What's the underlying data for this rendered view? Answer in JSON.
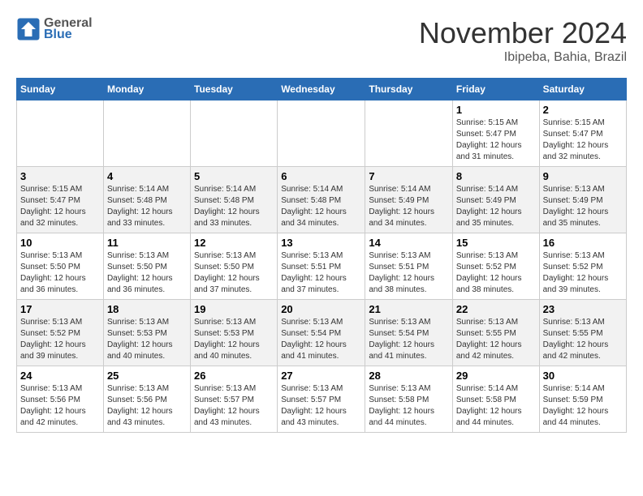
{
  "header": {
    "logo_general": "General",
    "logo_blue": "Blue",
    "month": "November 2024",
    "location": "Ibipeba, Bahia, Brazil"
  },
  "days_of_week": [
    "Sunday",
    "Monday",
    "Tuesday",
    "Wednesday",
    "Thursday",
    "Friday",
    "Saturday"
  ],
  "weeks": [
    [
      {
        "day": "",
        "info": ""
      },
      {
        "day": "",
        "info": ""
      },
      {
        "day": "",
        "info": ""
      },
      {
        "day": "",
        "info": ""
      },
      {
        "day": "",
        "info": ""
      },
      {
        "day": "1",
        "info": "Sunrise: 5:15 AM\nSunset: 5:47 PM\nDaylight: 12 hours and 31 minutes."
      },
      {
        "day": "2",
        "info": "Sunrise: 5:15 AM\nSunset: 5:47 PM\nDaylight: 12 hours and 32 minutes."
      }
    ],
    [
      {
        "day": "3",
        "info": "Sunrise: 5:15 AM\nSunset: 5:47 PM\nDaylight: 12 hours and 32 minutes."
      },
      {
        "day": "4",
        "info": "Sunrise: 5:14 AM\nSunset: 5:48 PM\nDaylight: 12 hours and 33 minutes."
      },
      {
        "day": "5",
        "info": "Sunrise: 5:14 AM\nSunset: 5:48 PM\nDaylight: 12 hours and 33 minutes."
      },
      {
        "day": "6",
        "info": "Sunrise: 5:14 AM\nSunset: 5:48 PM\nDaylight: 12 hours and 34 minutes."
      },
      {
        "day": "7",
        "info": "Sunrise: 5:14 AM\nSunset: 5:49 PM\nDaylight: 12 hours and 34 minutes."
      },
      {
        "day": "8",
        "info": "Sunrise: 5:14 AM\nSunset: 5:49 PM\nDaylight: 12 hours and 35 minutes."
      },
      {
        "day": "9",
        "info": "Sunrise: 5:13 AM\nSunset: 5:49 PM\nDaylight: 12 hours and 35 minutes."
      }
    ],
    [
      {
        "day": "10",
        "info": "Sunrise: 5:13 AM\nSunset: 5:50 PM\nDaylight: 12 hours and 36 minutes."
      },
      {
        "day": "11",
        "info": "Sunrise: 5:13 AM\nSunset: 5:50 PM\nDaylight: 12 hours and 36 minutes."
      },
      {
        "day": "12",
        "info": "Sunrise: 5:13 AM\nSunset: 5:50 PM\nDaylight: 12 hours and 37 minutes."
      },
      {
        "day": "13",
        "info": "Sunrise: 5:13 AM\nSunset: 5:51 PM\nDaylight: 12 hours and 37 minutes."
      },
      {
        "day": "14",
        "info": "Sunrise: 5:13 AM\nSunset: 5:51 PM\nDaylight: 12 hours and 38 minutes."
      },
      {
        "day": "15",
        "info": "Sunrise: 5:13 AM\nSunset: 5:52 PM\nDaylight: 12 hours and 38 minutes."
      },
      {
        "day": "16",
        "info": "Sunrise: 5:13 AM\nSunset: 5:52 PM\nDaylight: 12 hours and 39 minutes."
      }
    ],
    [
      {
        "day": "17",
        "info": "Sunrise: 5:13 AM\nSunset: 5:52 PM\nDaylight: 12 hours and 39 minutes."
      },
      {
        "day": "18",
        "info": "Sunrise: 5:13 AM\nSunset: 5:53 PM\nDaylight: 12 hours and 40 minutes."
      },
      {
        "day": "19",
        "info": "Sunrise: 5:13 AM\nSunset: 5:53 PM\nDaylight: 12 hours and 40 minutes."
      },
      {
        "day": "20",
        "info": "Sunrise: 5:13 AM\nSunset: 5:54 PM\nDaylight: 12 hours and 41 minutes."
      },
      {
        "day": "21",
        "info": "Sunrise: 5:13 AM\nSunset: 5:54 PM\nDaylight: 12 hours and 41 minutes."
      },
      {
        "day": "22",
        "info": "Sunrise: 5:13 AM\nSunset: 5:55 PM\nDaylight: 12 hours and 42 minutes."
      },
      {
        "day": "23",
        "info": "Sunrise: 5:13 AM\nSunset: 5:55 PM\nDaylight: 12 hours and 42 minutes."
      }
    ],
    [
      {
        "day": "24",
        "info": "Sunrise: 5:13 AM\nSunset: 5:56 PM\nDaylight: 12 hours and 42 minutes."
      },
      {
        "day": "25",
        "info": "Sunrise: 5:13 AM\nSunset: 5:56 PM\nDaylight: 12 hours and 43 minutes."
      },
      {
        "day": "26",
        "info": "Sunrise: 5:13 AM\nSunset: 5:57 PM\nDaylight: 12 hours and 43 minutes."
      },
      {
        "day": "27",
        "info": "Sunrise: 5:13 AM\nSunset: 5:57 PM\nDaylight: 12 hours and 43 minutes."
      },
      {
        "day": "28",
        "info": "Sunrise: 5:13 AM\nSunset: 5:58 PM\nDaylight: 12 hours and 44 minutes."
      },
      {
        "day": "29",
        "info": "Sunrise: 5:14 AM\nSunset: 5:58 PM\nDaylight: 12 hours and 44 minutes."
      },
      {
        "day": "30",
        "info": "Sunrise: 5:14 AM\nSunset: 5:59 PM\nDaylight: 12 hours and 44 minutes."
      }
    ]
  ]
}
